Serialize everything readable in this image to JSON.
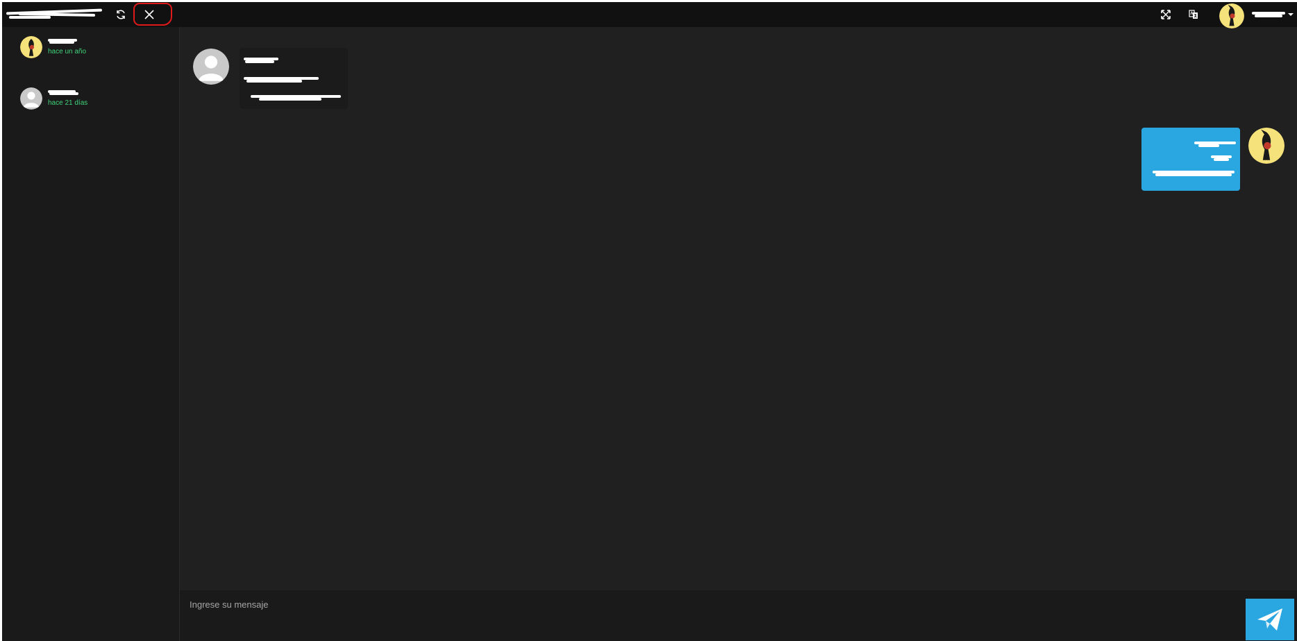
{
  "topbar": {
    "refresh_icon": "refresh-icon",
    "close_icon": "close-icon",
    "fullscreen_icon": "expand-icon",
    "translate_icon": "translate-icon"
  },
  "sidebar": {
    "contacts": [
      {
        "time": "hace un año",
        "avatar": "bird-avatar"
      },
      {
        "time": "hace 21 días",
        "avatar": "default-avatar"
      }
    ]
  },
  "composer": {
    "placeholder": "Ingrese su mensaje",
    "send_icon": "paper-plane-icon"
  },
  "colors": {
    "app_background": "#202020",
    "topbar": "#111111",
    "accent": "#2aa6e0",
    "online_time": "#3fd37a",
    "annotation": "#e01919"
  }
}
